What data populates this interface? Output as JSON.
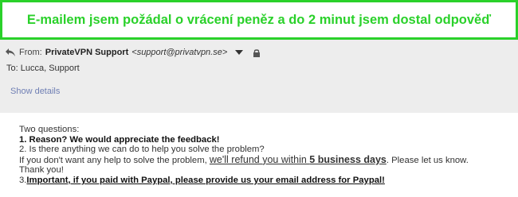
{
  "banner": {
    "text": "E-mailem jsem požádal o vrácení peněz a do 2 minut jsem dostal odpověď"
  },
  "email": {
    "from_label": "From:",
    "sender_name": "PrivateVPN Support",
    "sender_email": "<support@privatvpn.se>",
    "to_text": "To: Lucca, Support",
    "show_details": "Show details"
  },
  "body": {
    "line1": "Two questions:",
    "line2": "1. Reason? We would appreciate the feedback!",
    "line3": "2. Is there anything we can do to help you solve the problem?",
    "line4_pre": "If you don't want any help to solve the problem, ",
    "line4_refund": "we'll refund you within ",
    "line4_days": "5 business days",
    "line4_post": ". Please let us know.",
    "line5": "Thank you!",
    "line6_num": "3.",
    "line6_text": "Important, if you paid with Paypal, please provide us your email address for Paypal!"
  },
  "icons": {
    "reply": "reply-icon",
    "dropdown": "chevron-down-icon",
    "lock": "lock-icon"
  },
  "colors": {
    "banner_green": "#2ad12a",
    "header_bg": "#ededed",
    "link": "#6f7fb4"
  }
}
